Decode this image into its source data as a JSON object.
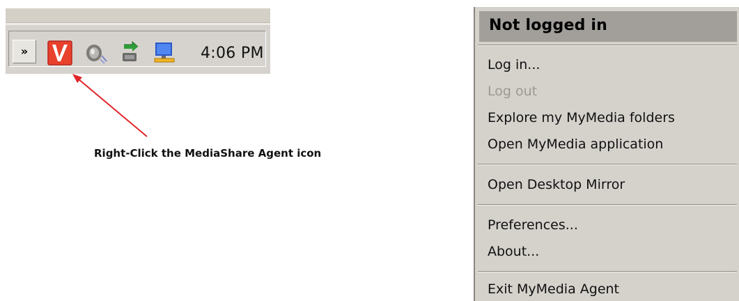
{
  "taskbar": {
    "chevron_label": "»",
    "clock": "4:06 PM",
    "icons": [
      "mediashare-agent-icon",
      "speaker-icon",
      "network-connection-icon",
      "network-computer-icon"
    ]
  },
  "callout": {
    "text": "Right-Click the MediaShare Agent icon",
    "arrow_color": "#e0262b"
  },
  "context_menu": {
    "header": "Not logged in",
    "groups": [
      {
        "items": [
          {
            "label": "Log in...",
            "enabled": true
          },
          {
            "label": "Log out",
            "enabled": false
          },
          {
            "label": "Explore my MyMedia folders",
            "enabled": true
          },
          {
            "label": "Open MyMedia application",
            "enabled": true
          }
        ]
      },
      {
        "items": [
          {
            "label": "Open Desktop Mirror",
            "enabled": true
          }
        ]
      },
      {
        "items": [
          {
            "label": "Preferences...",
            "enabled": true
          },
          {
            "label": "About...",
            "enabled": true
          }
        ]
      },
      {
        "items": [
          {
            "label": "Exit MyMedia Agent",
            "enabled": true
          }
        ]
      }
    ]
  },
  "colors": {
    "mediashare_red": "#e8412c",
    "menu_background": "#d5d2cc",
    "menu_header": "#a29f9a",
    "disabled_text": "#9c9993"
  }
}
